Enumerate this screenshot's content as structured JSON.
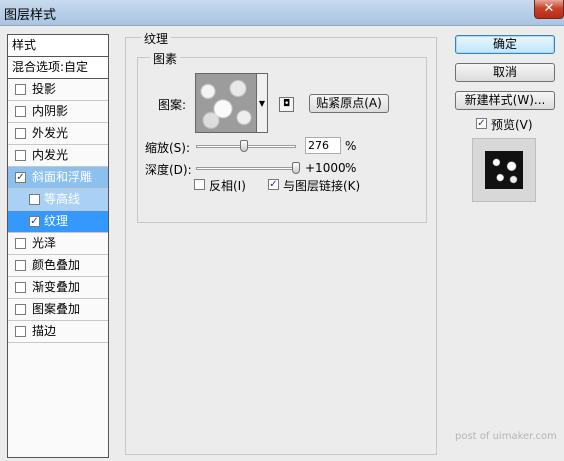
{
  "window": {
    "title": "图层样式",
    "close_label": "✕"
  },
  "style_list": {
    "header": "样式",
    "blend_options": "混合选项:自定",
    "items": [
      {
        "label": "投影",
        "checked": false
      },
      {
        "label": "内阴影",
        "checked": false
      },
      {
        "label": "外发光",
        "checked": false
      },
      {
        "label": "内发光",
        "checked": false
      },
      {
        "label": "斜面和浮雕",
        "checked": true
      },
      {
        "label": "等高线",
        "checked": false
      },
      {
        "label": "纹理",
        "checked": true
      },
      {
        "label": "光泽",
        "checked": false
      },
      {
        "label": "颜色叠加",
        "checked": false
      },
      {
        "label": "渐变叠加",
        "checked": false
      },
      {
        "label": "图案叠加",
        "checked": false
      },
      {
        "label": "描边",
        "checked": false
      }
    ]
  },
  "texture_panel": {
    "group_title": "纹理",
    "inner_group_title": "图素",
    "pattern_label": "图案:",
    "snap_button": "贴紧原点(A)",
    "scale": {
      "label": "缩放(S):",
      "value": "276",
      "unit": "%",
      "fraction": 0.276
    },
    "depth": {
      "label": "深度(D):",
      "value": "+1000",
      "unit": "%",
      "fraction": 1.0
    },
    "invert": {
      "label": "反相(I)",
      "checked": false
    },
    "link": {
      "label": "与图层链接(K)",
      "checked": true
    }
  },
  "buttons": {
    "ok": "确定",
    "cancel": "取消",
    "new_style": "新建样式(W)...",
    "preview_label": "预览(V)",
    "preview_checked": true
  },
  "watermark": "post of uimaker.com"
}
